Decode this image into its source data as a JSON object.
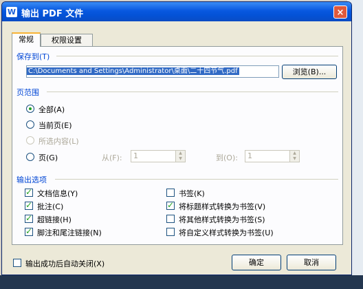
{
  "dialog": {
    "title": "输出 PDF 文件",
    "icon": "W",
    "close_label": "×"
  },
  "tabs": [
    {
      "label": "常规",
      "active": true
    },
    {
      "label": "权限设置",
      "active": false
    }
  ],
  "save_to": {
    "group_label": "保存到(T)",
    "path_value": "C:\\Documents and Settings\\Administrator\\桌面\\二十四节气.pdf",
    "browse_label": "浏览(B)..."
  },
  "page_range": {
    "group_label": "页范围",
    "options": [
      {
        "label": "全部(A)",
        "checked": true,
        "disabled": false
      },
      {
        "label": "当前页(E)",
        "checked": false,
        "disabled": false
      },
      {
        "label": "所选内容(L)",
        "checked": false,
        "disabled": true
      },
      {
        "label": "页(G)",
        "checked": false,
        "disabled": false
      }
    ],
    "from_label": "从(F):",
    "from_value": "1",
    "to_label": "到(O):",
    "to_value": "1"
  },
  "output_options": {
    "group_label": "输出选项",
    "left": [
      {
        "label": "文档信息(Y)",
        "checked": true
      },
      {
        "label": "批注(C)",
        "checked": true
      },
      {
        "label": "超链接(H)",
        "checked": true
      },
      {
        "label": "脚注和尾注链接(N)",
        "checked": true
      }
    ],
    "right": [
      {
        "label": "书签(K)",
        "checked": false
      },
      {
        "label": "将标题样式转换为书签(V)",
        "checked": true
      },
      {
        "label": "将其他样式转换为书签(S)",
        "checked": false
      },
      {
        "label": "将自定义样式转换为书签(U)",
        "checked": false
      }
    ]
  },
  "footer": {
    "auto_close_label": "输出成功后自动关闭(X)",
    "auto_close_checked": false,
    "ok_label": "确定",
    "cancel_label": "取消"
  },
  "colors": {
    "titlebar": "#0452d6",
    "group_title": "#0046d5",
    "selection": "#316ac5"
  }
}
